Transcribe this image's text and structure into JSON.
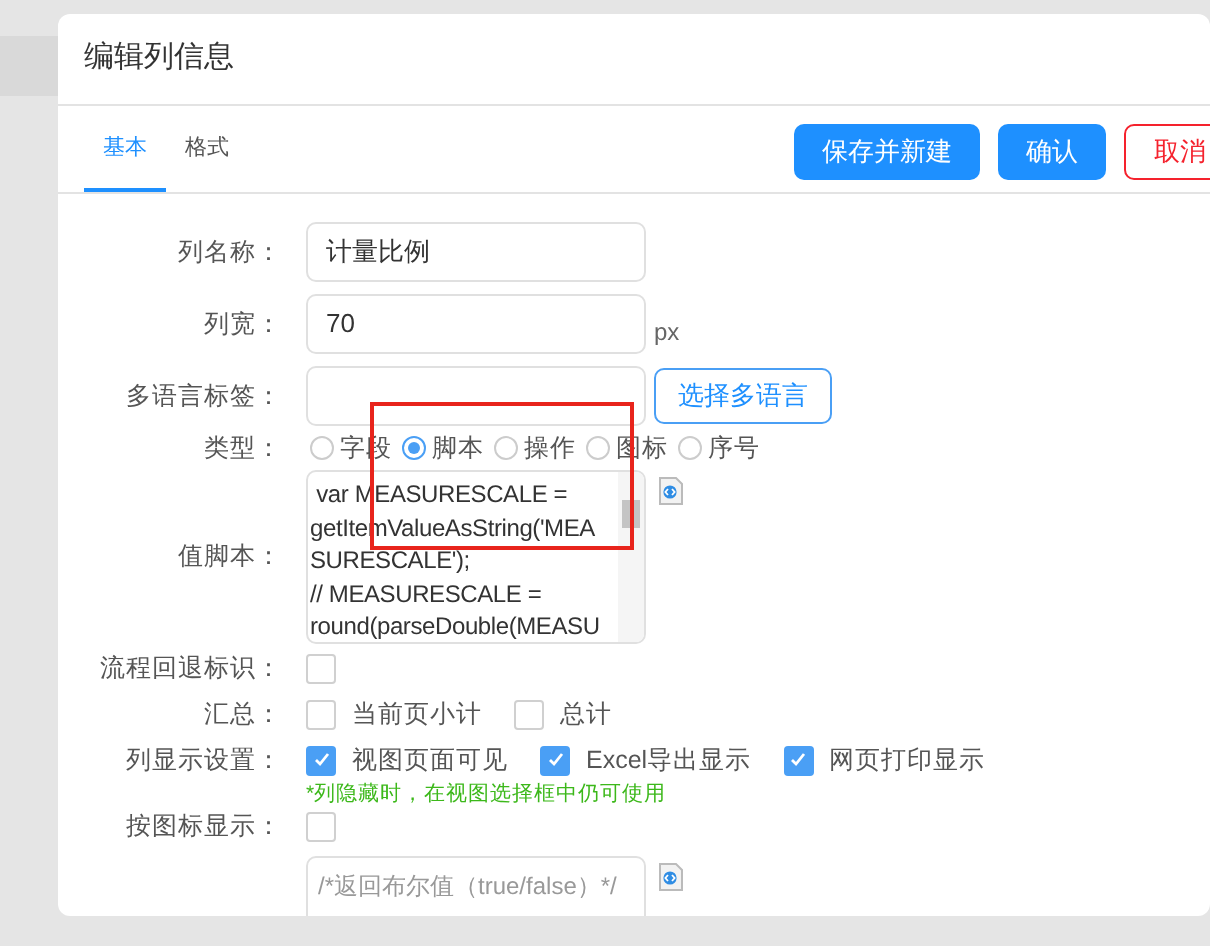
{
  "dialog": {
    "title": "编辑列信息"
  },
  "tabs": [
    {
      "label": "基本",
      "selected": true
    },
    {
      "label": "格式",
      "selected": false
    }
  ],
  "buttons": [
    {
      "label": "保存并新建",
      "kind": "primary"
    },
    {
      "label": "确认",
      "kind": "primary"
    },
    {
      "label": "取消",
      "kind": "danger"
    }
  ],
  "fields": [
    {
      "kind": "text",
      "label": "列名称：",
      "value": "计量比例"
    },
    {
      "kind": "text",
      "label": "列宽：",
      "value": "70",
      "suffix": "px"
    },
    {
      "kind": "text",
      "label": "多语言标签：",
      "button": "选择多语言"
    },
    {
      "kind": "radio",
      "label": "类型：",
      "options": [
        {
          "label": "字段",
          "selected": false
        },
        {
          "label": "脚本",
          "selected": true
        },
        {
          "label": "操作",
          "selected": false
        },
        {
          "label": "图标",
          "selected": false
        },
        {
          "label": "序号",
          "selected": false
        }
      ]
    },
    {
      "kind": "script",
      "label": "值脚本：",
      "lines": [
        " var MEASURESCALE =",
        "getItemValueAsString('MEA",
        "SURESCALE');",
        "// MEASURESCALE =",
        "round(parseDouble(MEASU"
      ]
    },
    {
      "kind": "checks",
      "label": "流程回退标识：",
      "options": [
        {
          "checked": false
        }
      ]
    },
    {
      "kind": "checks",
      "label": "汇总：",
      "options": [
        {
          "label": "当前页小计",
          "checked": false
        },
        {
          "label": "总计",
          "checked": false
        }
      ]
    },
    {
      "kind": "checks",
      "label": "列显示设置：",
      "options": [
        {
          "label": "视图页面可见",
          "checked": true
        },
        {
          "label": "Excel导出显示",
          "checked": true
        },
        {
          "label": "网页打印显示",
          "checked": true
        }
      ],
      "hint": "*列隐藏时，在视图选择框中仍可使用"
    },
    {
      "kind": "checks",
      "label": "按图标显示：",
      "options": [
        {
          "checked": false
        }
      ]
    },
    {
      "kind": "script",
      "placeholder": "/*返回布尔值（true/false）*/"
    }
  ]
}
